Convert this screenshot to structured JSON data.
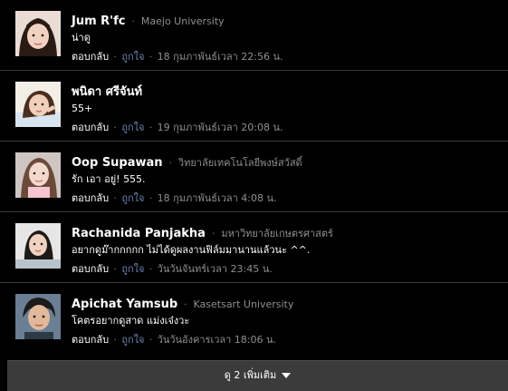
{
  "comments": [
    {
      "name": "Jum R'fc",
      "network": "Maejo University",
      "text": "น่าดู",
      "reply": "ตอบกลับ",
      "like": "ถูกใจ",
      "time": "18 กุมภาพันธ์เวลา 22:56 น."
    },
    {
      "name": "พนิดา ศรีจันท์",
      "network": "",
      "text": "55+",
      "reply": "ตอบกลับ",
      "like": "ถูกใจ",
      "time": "19 กุมภาพันธ์เวลา 20:08 น."
    },
    {
      "name": "Oop Supawan",
      "network": "วิทยาลัยเทคโนโลยีพงษ์สวัสดิ์",
      "text": "รัก เอา อยู่! 555.",
      "reply": "ตอบกลับ",
      "like": "ถูกใจ",
      "time": "18 กุมภาพันธ์เวลา 4:08 น."
    },
    {
      "name": "Rachanida Panjakha",
      "network": "มหาวิทยาลัยเกษตรศาสตร์",
      "text": "อยากดูม๊ากกกกก ไม่ได้ดูผลงานฟิล์มมานานแล้วนะ ^^.",
      "reply": "ตอบกลับ",
      "like": "ถูกใจ",
      "time": "วันวันจันทร์เวลา 23:45 น."
    },
    {
      "name": "Apichat Yamsub",
      "network": "Kasetsart University",
      "text": "โคตรอยากดูสาด แม่งเจ๋งวะ",
      "reply": "ตอบกลับ",
      "like": "ถูกใจ",
      "time": "วันวันอังคารเวลา 18:06 น."
    }
  ],
  "separator": "·",
  "more": {
    "label": "ดู 2 เพิ่มเติม"
  }
}
